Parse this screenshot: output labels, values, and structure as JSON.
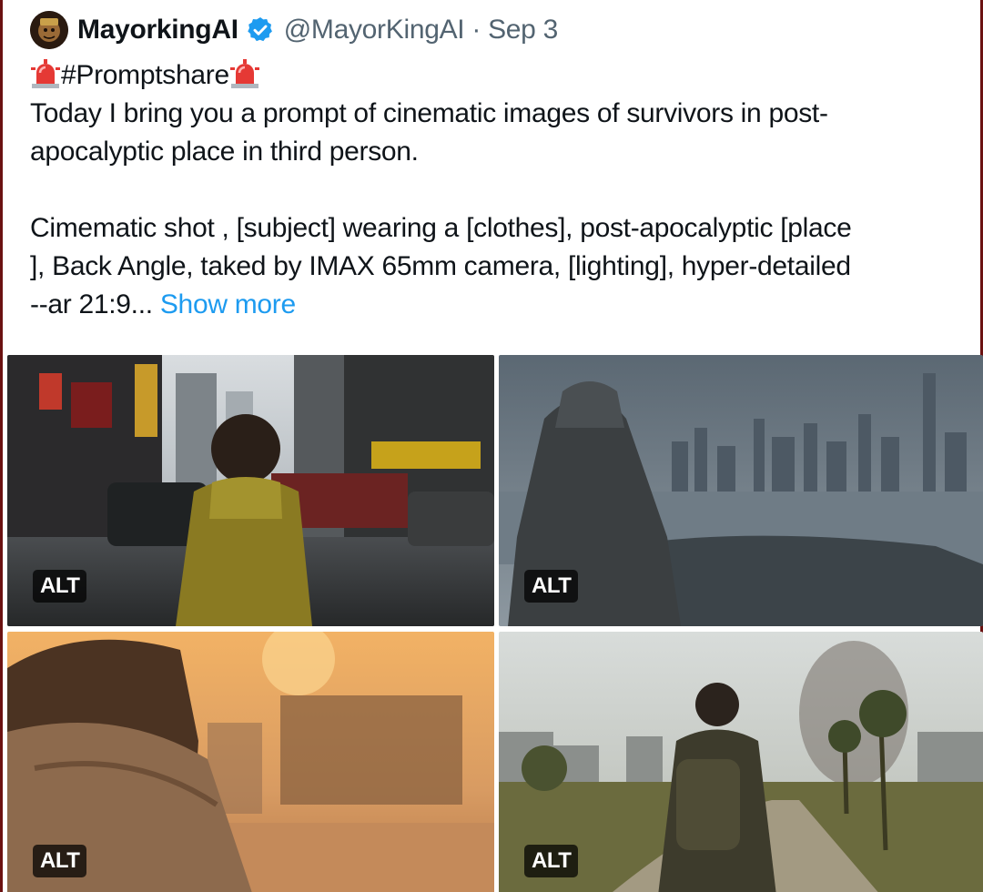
{
  "tweet": {
    "author": {
      "display_name": "MayorkingAI",
      "verified": true,
      "handle_and_date": "@MayorKingAI · Sep 3"
    },
    "hashtag": "#Promptshare",
    "body_lines": [
      "Today I bring you a prompt of cinematic images of survivors in post-",
      "apocalyptic place in third person."
    ],
    "prompt_lines": [
      "Cimematic shot , [subject] wearing a [clothes],  post-apocalyptic [place",
      "], Back Angle, taked by IMAX 65mm camera, [lighting],  hyper-detailed",
      "--ar 21:9..."
    ],
    "show_more": "Show more"
  },
  "media": [
    {
      "alt_label": "ALT",
      "scene": "child in yellow raincoat in ruined city street"
    },
    {
      "alt_label": "ALT",
      "scene": "hooded figure overlooking flooded city skyline"
    },
    {
      "alt_label": "ALT",
      "scene": "windblown hair figure at dusty sunset ruins"
    },
    {
      "alt_label": "ALT",
      "scene": "backpacker walking toward overgrown city with smoke"
    }
  ],
  "colors": {
    "link": "#1d9bf0",
    "verified": "#1d9bf0",
    "muted_text": "#536471",
    "frame_border": "#6b1111"
  },
  "icons": [
    "avatar",
    "verified-badge-icon",
    "siren-icon"
  ]
}
